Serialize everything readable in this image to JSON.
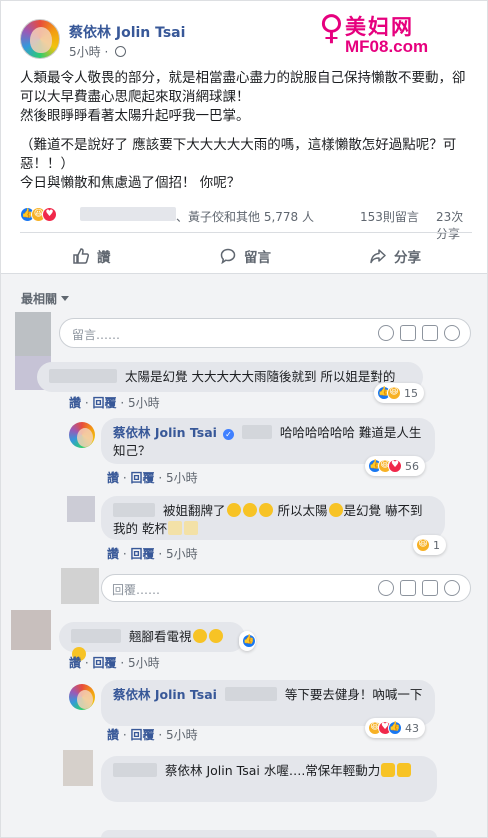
{
  "post": {
    "author": "蔡依林 Jolin Tsai",
    "time": "5小時",
    "lines": [
      "人類最令人敬畏的部分，就是相當盡心盡力的說服自己保持懶散不要動，卻可以大早費盡心思爬起來取消網球課！",
      "然後眼睜睜看著太陽升起呼我一巴掌。",
      "（難道不是說好了 應該要下大大大大大雨的嗎，這樣懶散怎好過點呢？可惡！！）",
      "今日與懶散和焦慮過了個招！ 你呢？"
    ],
    "reactions_names": "、黃子佼和其他 5,778 人",
    "comments_count": "153則留言",
    "shares_count": "23次分享",
    "actions": {
      "like": "讚",
      "comment": "留言",
      "share": "分享"
    }
  },
  "watermark": {
    "cn": "美妇网",
    "url": "MF08.com"
  },
  "comments": {
    "sort_label": "最相關",
    "input_placeholder": "留言……",
    "reply_placeholder": "回覆……",
    "like_label": "讚",
    "reply_label": "回覆",
    "sep": "·",
    "c1": {
      "text": "太陽是幻覺 大大大大大雨隨後就到 所以姐是對的",
      "time": "5小時",
      "count": "15"
    },
    "r1": {
      "author": "蔡依林 Jolin Tsai",
      "text": "哈哈哈哈哈哈 難道是人生知己？",
      "time": "5小時",
      "count": "56"
    },
    "r2": {
      "text1": "被姐翻牌了",
      "text2": "所以太陽",
      "text3": "是幻覺 嚇不到我的 乾杯",
      "time": "5小時",
      "count": "1"
    },
    "c2": {
      "text": "翹腳看電視",
      "time": "5小時"
    },
    "r3": {
      "author": "蔡依林 Jolin Tsai",
      "text": "等下要去健身！吶喊一下",
      "time": "5小時",
      "count": "43"
    },
    "r4": {
      "text": "蔡依林 Jolin Tsai 水喔….常保年輕動力"
    }
  }
}
